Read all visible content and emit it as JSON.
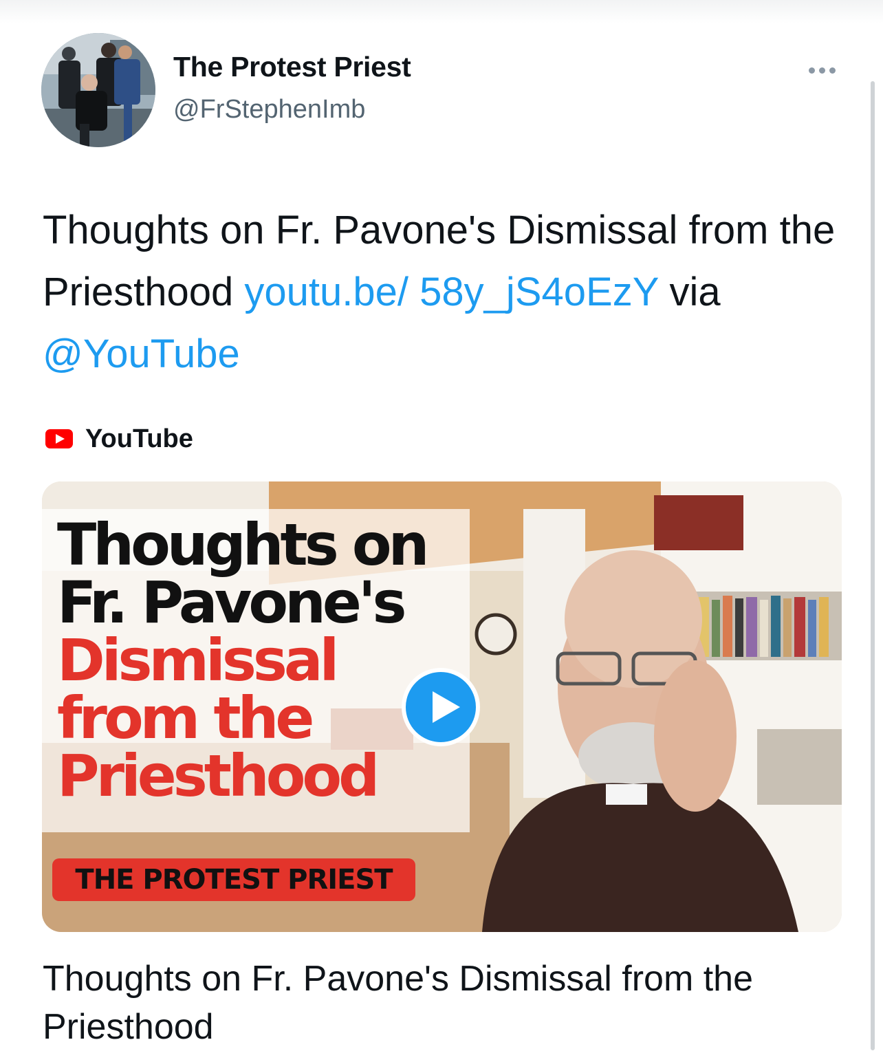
{
  "tweet": {
    "display_name": "The Protest Priest",
    "handle": "@FrStephenImb",
    "text_plain": "Thoughts on Fr. Pavone's Dismissal from the Priesthood ",
    "link_text": "youtu.be/ 58y_jS4oEzY",
    "via_text": " via ",
    "mention": "@YouTube"
  },
  "link_card": {
    "source_label": "YouTube",
    "source_icon": "youtube-icon",
    "thumbnail": {
      "line1": "Thoughts on",
      "line2": "Fr. Pavone's",
      "line3": "Dismissal",
      "line4": "from the",
      "line5": "Priesthood",
      "banner": "THE PROTEST PRIEST"
    },
    "title": "Thoughts on Fr. Pavone's Dismissal from the Priesthood"
  },
  "icons": [
    "more-icon",
    "youtube-icon",
    "play-icon"
  ],
  "colors": {
    "link": "#1d9bf0",
    "text": "#0f1419",
    "secondary": "#536471",
    "thumbnail_red": "#e3342b"
  }
}
